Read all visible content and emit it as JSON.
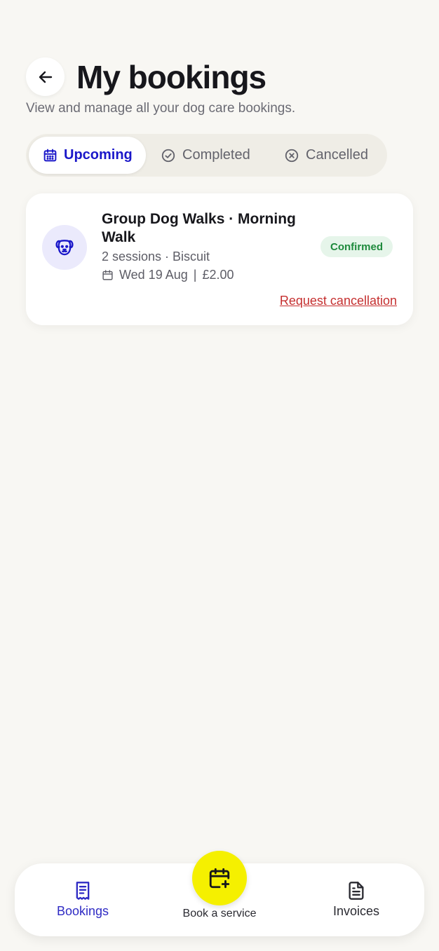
{
  "header": {
    "title": "My bookings",
    "subtitle": "View and manage all your dog care bookings."
  },
  "tabs": [
    {
      "label": "Upcoming",
      "active": true,
      "icon": "calendar-icon"
    },
    {
      "label": "Completed",
      "active": false,
      "icon": "check-circle-icon"
    },
    {
      "label": "Cancelled",
      "active": false,
      "icon": "x-circle-icon"
    }
  ],
  "booking": {
    "title": "Group Dog Walks · Morning Walk",
    "meta": "2 sessions · Biscuit",
    "date": "Wed 19 Aug",
    "separator": "|",
    "price": "£2.00",
    "status": "Confirmed",
    "cancel_label": "Request cancellation",
    "icon": "dog-face-icon"
  },
  "bottom_nav": {
    "bookings_label": "Bookings",
    "book_label": "Book a service",
    "invoices_label": "Invoices"
  },
  "colors": {
    "background": "#f8f7f3",
    "accent": "#1a17c9",
    "fab": "#f5f000",
    "status_bg": "#e6f5ea",
    "status_text": "#1e8a3c",
    "danger": "#c52f2f"
  }
}
